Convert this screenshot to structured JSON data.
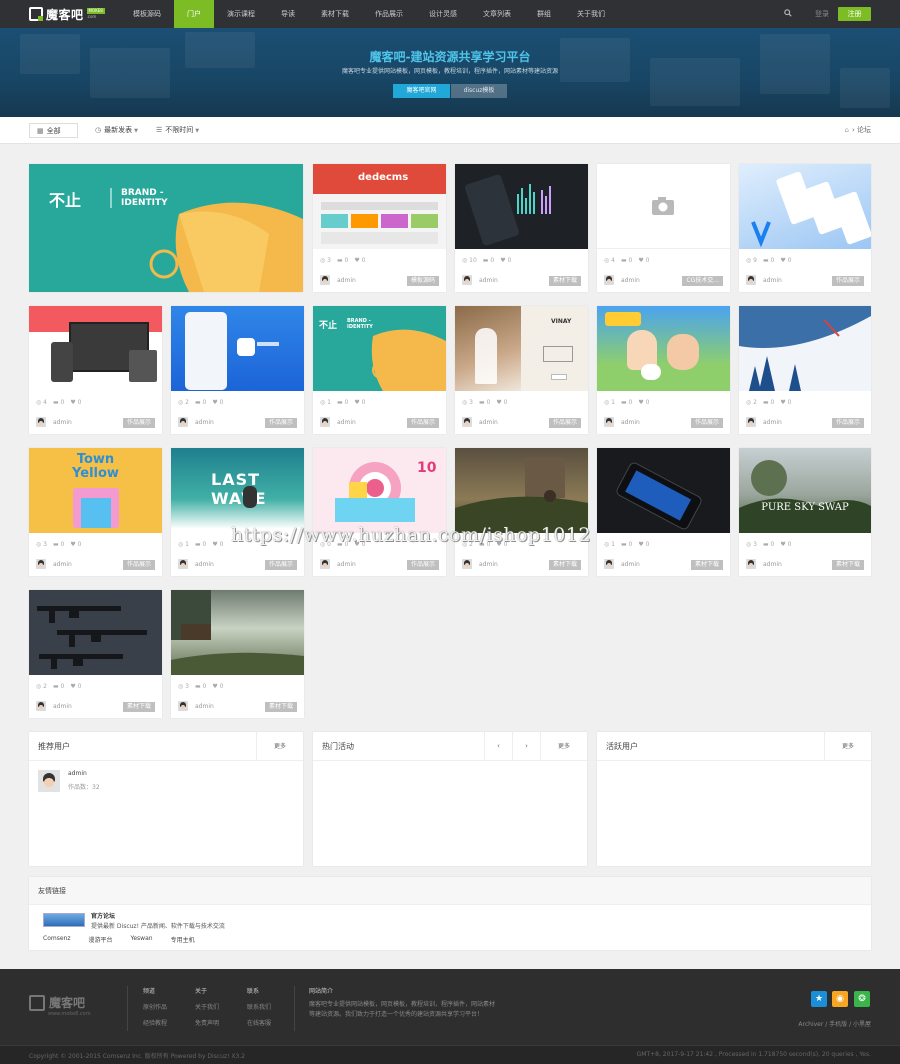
{
  "nav": {
    "logo_text": "魔客吧",
    "logo_badge": "MOKE8",
    "logo_domain": ".com",
    "items": [
      "模板源码",
      "门户",
      "演示课程",
      "导读",
      "素材下载",
      "作品展示",
      "设计灵感",
      "文章列表",
      "群组",
      "关于我们"
    ],
    "active_index": 1,
    "login": "登录",
    "register": "注册"
  },
  "banner": {
    "title": "魔客吧-建站资源共享学习平台",
    "subtitle": "魔客吧专业提供网站模板，网页模板，教程培训，程序插件，网站素材等建站资源",
    "btn_primary": "魔客吧官网",
    "btn_secondary": "discuz模板"
  },
  "filters": {
    "all": "全部",
    "latest": "最新发表",
    "time": "不限时间",
    "breadcrumb": "论坛"
  },
  "cards": [
    {
      "views": "",
      "replies": "",
      "likes": "",
      "author": "",
      "tag": ""
    },
    {
      "views": "3",
      "replies": "0",
      "likes": "0",
      "author": "admin",
      "tag": "模板源码"
    },
    {
      "views": "10",
      "replies": "0",
      "likes": "0",
      "author": "admin",
      "tag": "素材下载"
    },
    {
      "views": "4",
      "replies": "0",
      "likes": "0",
      "author": "admin",
      "tag": "CG技术交..."
    },
    {
      "views": "9",
      "replies": "0",
      "likes": "0",
      "author": "admin",
      "tag": "作品展示"
    },
    {
      "views": "4",
      "replies": "0",
      "likes": "0",
      "author": "admin",
      "tag": "作品展示"
    },
    {
      "views": "2",
      "replies": "0",
      "likes": "0",
      "author": "admin",
      "tag": "作品展示"
    },
    {
      "views": "1",
      "replies": "0",
      "likes": "0",
      "author": "admin",
      "tag": "作品展示"
    },
    {
      "views": "3",
      "replies": "0",
      "likes": "0",
      "author": "admin",
      "tag": "作品展示"
    },
    {
      "views": "1",
      "replies": "0",
      "likes": "0",
      "author": "admin",
      "tag": "作品展示"
    },
    {
      "views": "2",
      "replies": "0",
      "likes": "0",
      "author": "admin",
      "tag": "作品展示"
    },
    {
      "views": "3",
      "replies": "0",
      "likes": "0",
      "author": "admin",
      "tag": "作品展示"
    },
    {
      "views": "1",
      "replies": "0",
      "likes": "0",
      "author": "admin",
      "tag": "作品展示"
    },
    {
      "views": "0",
      "replies": "0",
      "likes": "0",
      "author": "admin",
      "tag": "作品展示"
    },
    {
      "views": "2",
      "replies": "0",
      "likes": "0",
      "author": "admin",
      "tag": "素材下载"
    },
    {
      "views": "1",
      "replies": "0",
      "likes": "0",
      "author": "admin",
      "tag": "素材下载"
    },
    {
      "views": "3",
      "replies": "0",
      "likes": "0",
      "author": "admin",
      "tag": "素材下载"
    },
    {
      "views": "2",
      "replies": "0",
      "likes": "0",
      "author": "admin",
      "tag": "素材下载"
    },
    {
      "views": "3",
      "replies": "0",
      "likes": "0",
      "author": "admin",
      "tag": "素材下载"
    }
  ],
  "thumb_text": {
    "feature_brand": "BRAND -",
    "feature_identity": "IDENTITY",
    "dedecms": "dedecms",
    "vinay": "VINAY",
    "town": "Town",
    "yellow": "Yellow",
    "last_wave": "LAST WAVE",
    "ten": "10",
    "pure_sky": "PURE SKY SWAP"
  },
  "panels": {
    "recommend_title": "推荐用户",
    "hot_title": "热门活动",
    "active_title": "活跃用户",
    "more": "更多",
    "user_name": "admin",
    "user_works": "作品数：32"
  },
  "links": {
    "title": "友情链接",
    "site_name": "官方论坛",
    "site_desc": "提供最新 Discuz! 产品新闻、软件下载与技术交流",
    "items": [
      "Comsenz",
      "漫游平台",
      "Yeswan",
      "专用主机"
    ]
  },
  "footer": {
    "logo_text": "魔客吧",
    "logo_url": "www.moke8.com",
    "col1": {
      "title": "频道",
      "items": [
        "原创作品",
        "经验教程"
      ]
    },
    "col2": {
      "title": "关于",
      "items": [
        "关于我们",
        "免责声明"
      ]
    },
    "col3": {
      "title": "联系",
      "items": [
        "联系我们",
        "在线客服"
      ]
    },
    "intro_title": "网站简介",
    "intro_text": "魔客吧专业提供网站模板，网页模板，教程培训，程序插件，网站素材等建站资源。我们致力于打造一个优秀的建站资源共享学习平台！",
    "links_text": "Archiver / 手机版 / 小黑屋",
    "copyright": "Copyright © 2001-2015 Comsenz Inc. 版权所有 Powered by Discuz! X3.2",
    "stats": "GMT+8, 2017-9-17 21:42 , Processed in 1.718750 second(s), 20 queries , Yes."
  },
  "watermark": "https://www.huzhan.com/ishop1012",
  "colors": {
    "accent": "#7cbd26",
    "nav_bg": "#2f3134",
    "banner_button": "#22a8d8"
  }
}
